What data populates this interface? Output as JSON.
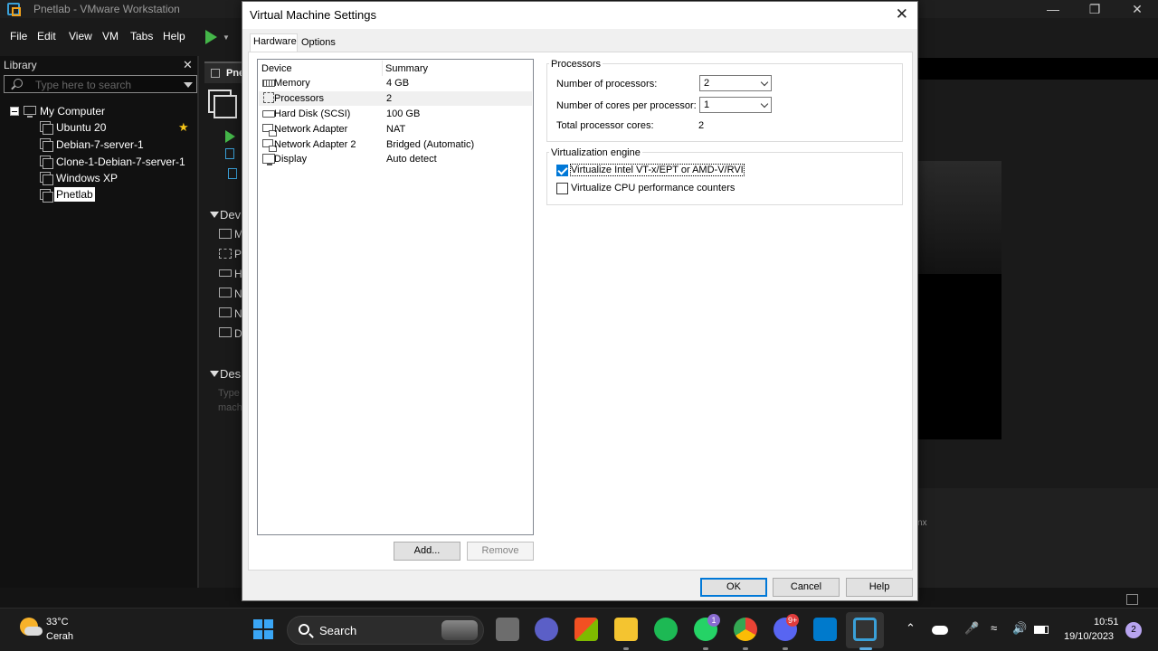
{
  "app": {
    "title": "Pnetlab - VMware Workstation",
    "menu": [
      "File",
      "Edit",
      "View",
      "VM",
      "Tabs",
      "Help"
    ]
  },
  "library": {
    "header": "Library",
    "search_placeholder": "Type here to search",
    "root": "My Computer",
    "items": [
      "Ubuntu 20",
      "Debian-7-server-1",
      "Clone-1-Debian-7-server-1",
      "Windows XP",
      "Pnetlab"
    ]
  },
  "vm_panel": {
    "tab_label": "Pne",
    "devices_head": "Dev",
    "devices_initials": [
      "M",
      "P",
      "H",
      "N",
      "N",
      "D"
    ],
    "description_head": "Des",
    "description_text": "Type machi",
    "fragment_right": "nx"
  },
  "dialog": {
    "title": "Virtual Machine Settings",
    "tabs": [
      "Hardware",
      "Options"
    ],
    "device_list": {
      "col_device": "Device",
      "col_summary": "Summary",
      "rows": [
        {
          "icon": "memory-icon",
          "name": "Memory",
          "summary": "4 GB"
        },
        {
          "icon": "processor-icon",
          "name": "Processors",
          "summary": "2"
        },
        {
          "icon": "hard-disk-icon",
          "name": "Hard Disk (SCSI)",
          "summary": "100 GB"
        },
        {
          "icon": "network-adapter-icon",
          "name": "Network Adapter",
          "summary": "NAT"
        },
        {
          "icon": "network-adapter-icon",
          "name": "Network Adapter 2",
          "summary": "Bridged (Automatic)"
        },
        {
          "icon": "display-icon",
          "name": "Display",
          "summary": "Auto detect"
        }
      ]
    },
    "add_label": "Add...",
    "remove_label": "Remove",
    "processors": {
      "group_title": "Processors",
      "num_processors_label": "Number of processors:",
      "num_processors_value": "2",
      "cores_label": "Number of cores per processor:",
      "cores_value": "1",
      "total_label": "Total processor cores:",
      "total_value": "2"
    },
    "virtualization": {
      "group_title": "Virtualization engine",
      "vtx_label": "Virtualize Intel VT-x/EPT or AMD-V/RVI",
      "vtx_checked": true,
      "perf_label": "Virtualize CPU performance counters",
      "perf_checked": false
    },
    "ok_label": "OK",
    "cancel_label": "Cancel",
    "help_label": "Help"
  },
  "taskbar": {
    "weather_temp": "33°C",
    "weather_desc": "Cerah",
    "search_label": "Search",
    "whatsapp_badge": "1",
    "discord_badge": "9+",
    "time": "10:51",
    "date": "19/10/2023",
    "notifications": "2"
  },
  "colors": {
    "accent": "#0078d7",
    "play": "#44b649",
    "star": "#f5c518"
  }
}
